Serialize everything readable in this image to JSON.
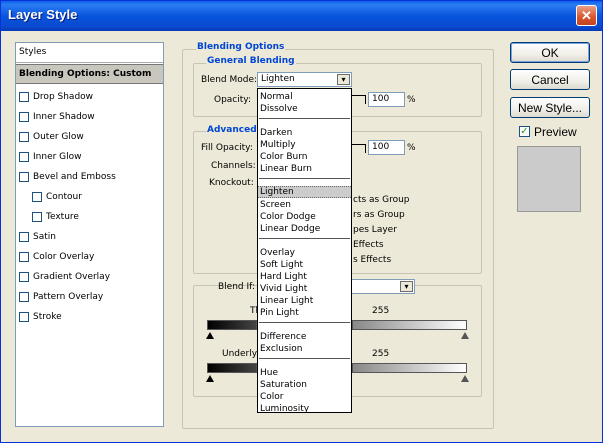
{
  "window": {
    "title": "Layer Style",
    "close_glyph": "✕"
  },
  "styles": {
    "header": "Styles",
    "items": [
      {
        "label": "Blending Options: Custom",
        "selected": true,
        "checkbox": false
      },
      {
        "label": "Drop Shadow",
        "checkbox": true
      },
      {
        "label": "Inner Shadow",
        "checkbox": true
      },
      {
        "label": "Outer Glow",
        "checkbox": true
      },
      {
        "label": "Inner Glow",
        "checkbox": true
      },
      {
        "label": "Bevel and Emboss",
        "checkbox": true
      },
      {
        "label": "Contour",
        "checkbox": true,
        "indent": true
      },
      {
        "label": "Texture",
        "checkbox": true,
        "indent": true
      },
      {
        "label": "Satin",
        "checkbox": true
      },
      {
        "label": "Color Overlay",
        "checkbox": true
      },
      {
        "label": "Gradient Overlay",
        "checkbox": true
      },
      {
        "label": "Pattern Overlay",
        "checkbox": true
      },
      {
        "label": "Stroke",
        "checkbox": true
      }
    ]
  },
  "blending": {
    "title": "Blending Options",
    "general": {
      "title": "General Blending",
      "blend_mode_label": "Blend Mode:",
      "blend_mode_value": "Lighten",
      "opacity_label": "Opacity:",
      "opacity_value": "100",
      "opacity_unit": "%"
    },
    "advanced": {
      "title": "Advanced",
      "fill_opacity_label": "Fill Opacity:",
      "fill_opacity_value": "100",
      "fill_opacity_unit": "%",
      "channels_label": "Channels:",
      "knockout_label": "Knockout:",
      "partial_options": [
        "cts as Group",
        "rs as Group",
        "pes Layer",
        "Effects",
        "s Effects"
      ]
    },
    "blend_if": {
      "label": "Blend If:",
      "this_layer_partial": "Th",
      "this_layer_max": "255",
      "underlying_partial": "Underly",
      "underlying_max": "255"
    }
  },
  "dropdown": {
    "groups": [
      [
        "Normal",
        "Dissolve"
      ],
      [
        "Darken",
        "Multiply",
        "Color Burn",
        "Linear Burn"
      ],
      [
        "Lighten",
        "Screen",
        "Color Dodge",
        "Linear Dodge"
      ],
      [
        "Overlay",
        "Soft Light",
        "Hard Light",
        "Vivid Light",
        "Linear Light",
        "Pin Light"
      ],
      [
        "Difference",
        "Exclusion"
      ],
      [
        "Hue",
        "Saturation",
        "Color",
        "Luminosity"
      ]
    ],
    "highlighted": "Lighten"
  },
  "buttons": {
    "ok": "OK",
    "cancel": "Cancel",
    "new_style": "New Style...",
    "preview_label": "Preview",
    "preview_checked": true
  },
  "icons": {
    "dropdown_arrow": "▾",
    "checkmark": "✓",
    "slider_handle": "▲"
  },
  "colors": {
    "title_bar": "#0a5fe6",
    "group_title": "#0046d5",
    "selection": "#c9c6bd"
  }
}
